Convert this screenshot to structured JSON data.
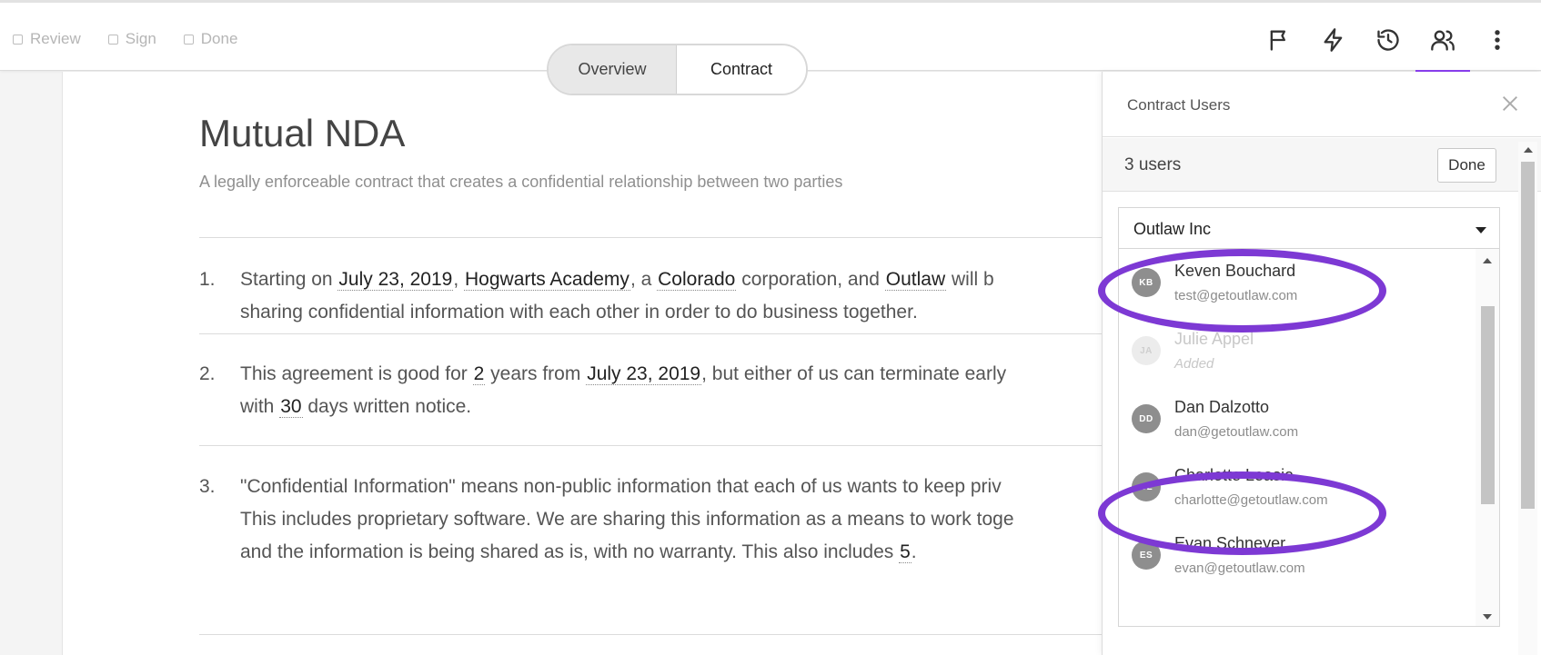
{
  "steps": [
    {
      "label": "Review"
    },
    {
      "label": "Sign"
    },
    {
      "label": "Done"
    }
  ],
  "tabs": {
    "overview": "Overview",
    "contract": "Contract",
    "active": "Contract"
  },
  "toolbar": {
    "icons": [
      "flag-icon",
      "lightning-icon",
      "history-icon",
      "users-icon",
      "more-vertical-icon"
    ],
    "active": "users-icon",
    "accent_color": "#8a3ff0"
  },
  "document": {
    "title": "Mutual NDA",
    "subtitle": "A legally enforceable contract that creates a confidential relationship between two parties",
    "clauses": [
      {
        "num": "1.",
        "line1": {
          "t1": "Starting on ",
          "f1": "July 23, 2019",
          "t2": ", ",
          "f2": "Hogwarts Academy",
          "t3": ", a ",
          "f3": "Colorado",
          "t4": " corporation, and ",
          "f4": "Outlaw",
          "t5": " will b"
        },
        "line2": "sharing confidential information with each other in order to do business together."
      },
      {
        "num": "2.",
        "line1": {
          "t1": "This agreement is good for ",
          "f1": "2",
          "t2": " years from ",
          "f2": "July 23, 2019",
          "t3": ", but either of us can terminate early"
        },
        "line2": {
          "t1": "with ",
          "f1": "30",
          "t2": " days written notice."
        }
      },
      {
        "num": "3.",
        "line1": "\"Confidential Information\" means non-public information that each of us wants to keep priv",
        "line2": "This includes proprietary software. We are sharing this information as a means to work toge",
        "line3": {
          "t1": "and the information is being shared as is, with no warranty. This also includes ",
          "f1": "5",
          "t2": "."
        }
      }
    ]
  },
  "panel": {
    "title": "Contract Users",
    "count": "3 users",
    "done_label": "Done",
    "organization": "Outlaw Inc",
    "users": [
      {
        "initials": "KB",
        "name": "Keven Bouchard",
        "sub": "test@getoutlaw.com",
        "disabled": false,
        "highlighted": true
      },
      {
        "initials": "JA",
        "name": "Julie Appel",
        "sub": "Added",
        "disabled": true,
        "highlighted": false
      },
      {
        "initials": "DD",
        "name": "Dan Dalzotto",
        "sub": "dan@getoutlaw.com",
        "disabled": false,
        "highlighted": false
      },
      {
        "initials": "CL",
        "name": "Charlotte Leasia",
        "sub": "charlotte@getoutlaw.com",
        "disabled": false,
        "highlighted": true
      },
      {
        "initials": "ES",
        "name": "Evan Schneyer",
        "sub": "evan@getoutlaw.com",
        "disabled": false,
        "highlighted": false
      }
    ],
    "highlight_color": "#7d39d4"
  }
}
